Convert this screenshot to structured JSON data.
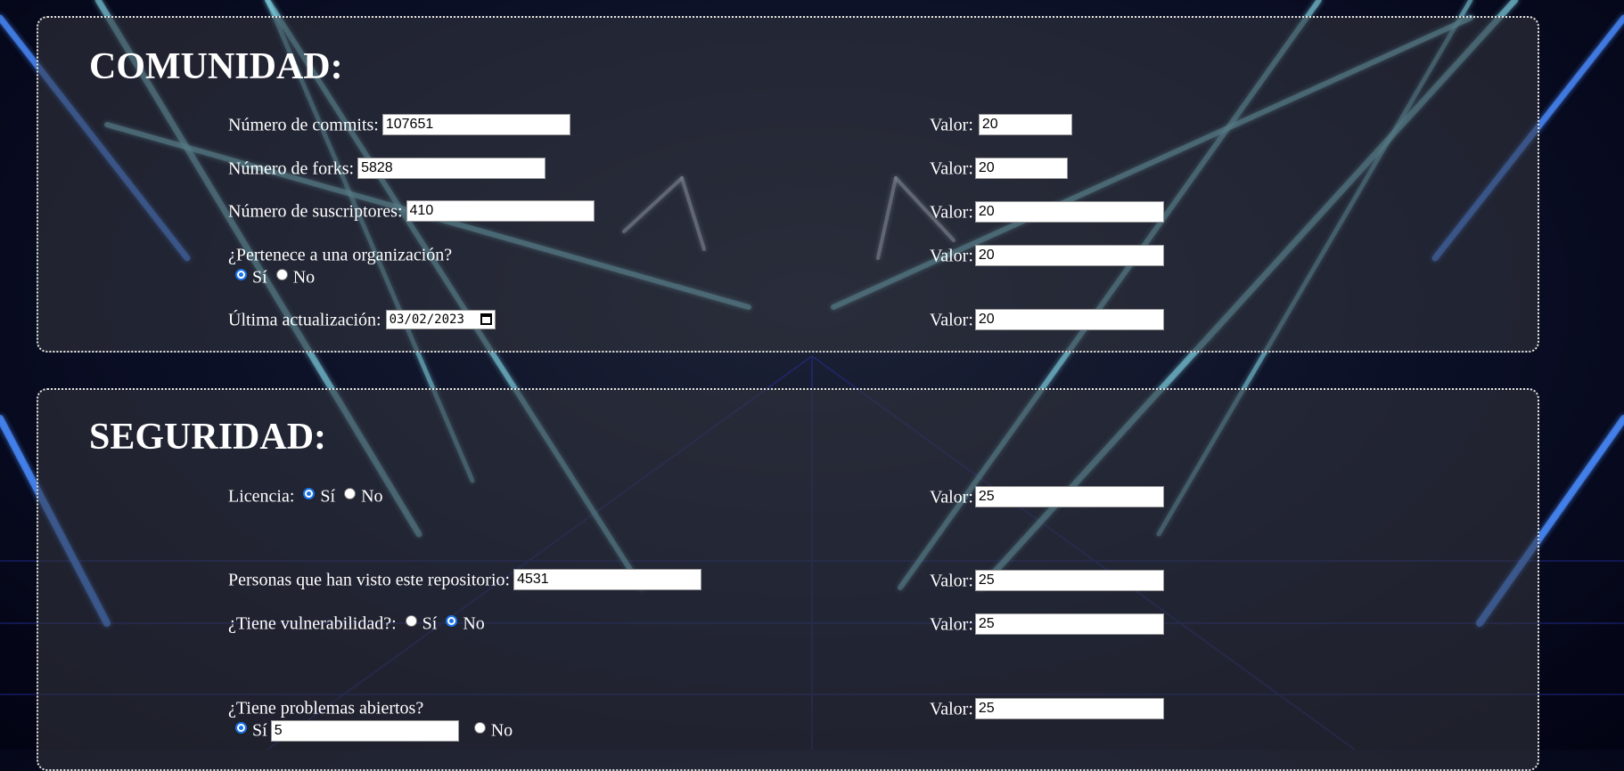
{
  "comunidad": {
    "title": "COMUNIDAD:",
    "valor_label": "Valor:",
    "commits": {
      "label": "Número de commits:",
      "value": "107651",
      "valor": "20"
    },
    "forks": {
      "label": "Número de forks:",
      "value": "5828",
      "valor": "20"
    },
    "suscriptores": {
      "label": "Número de suscriptores:",
      "value": "410",
      "valor": "20"
    },
    "organizacion": {
      "label": "¿Pertenece a una organización?",
      "yes": "Sí",
      "no": "No",
      "selected": "Sí",
      "valor": "20"
    },
    "actualizacion": {
      "label": "Última actualización:",
      "value": "03/02/2023",
      "valor": "20"
    }
  },
  "seguridad": {
    "title": "SEGURIDAD:",
    "valor_label": "Valor:",
    "licencia": {
      "label": "Licencia:",
      "yes": "Sí",
      "no": "No",
      "selected": "Sí",
      "valor": "25"
    },
    "vistas": {
      "label": "Personas que han visto este repositorio:",
      "value": "4531",
      "valor": "25"
    },
    "vulnerabilidad": {
      "label": "¿Tiene vulnerabilidad?:",
      "yes": "Sí",
      "no": "No",
      "selected": "No",
      "valor": "25"
    },
    "problemas": {
      "label": "¿Tiene problemas abiertos?",
      "yes": "Sí",
      "no": "No",
      "selected": "Sí",
      "count": "5",
      "valor": "25"
    }
  },
  "colors": {
    "panel_border": "#e6e6e6",
    "radio_accent": "#1a73e8",
    "neon_blue": "#4a8cff",
    "neon_cyan": "#7fd0e0"
  }
}
